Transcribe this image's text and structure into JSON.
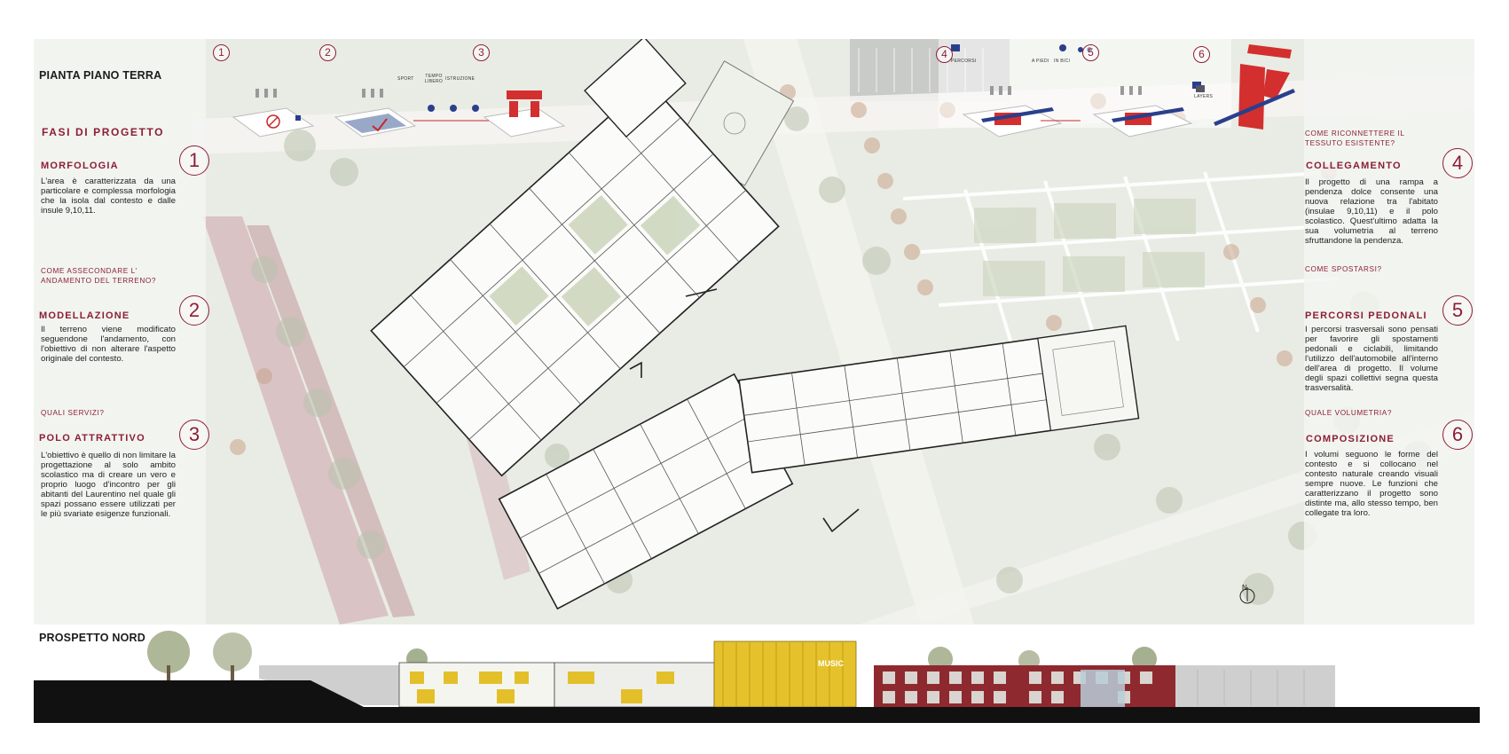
{
  "plan_title": "PIANTA PIANO TERRA",
  "elevation_title": "PROSPETTO NORD",
  "phases_title": "FASI DI PROGETTO",
  "steps": [
    {
      "number": "1",
      "question": "",
      "heading": "MORFOLOGIA",
      "body": "L'area è caratterizzata da una particolare e complessa morfologia che la isola dal contesto e dalle insule 9,10,11."
    },
    {
      "number": "2",
      "question": "COME ASSECONDARE L' ANDAMENTO DEL TERRENO?",
      "heading": "MODELLAZIONE",
      "body": "Il terreno viene modificato seguendone l'andamento, con l'obiettivo di non alterare l'aspetto originale del contesto."
    },
    {
      "number": "3",
      "question": "QUALI SERVIZI?",
      "heading": "POLO ATTRATTIVO",
      "body": "L'obiettivo è quello di non limitare la progettazione al solo ambito scolastico ma di creare un vero e proprio luogo d'incontro per gli abitanti del Laurentino nel quale gli spazi possano essere utilizzati per le più svariate esigenze funzionali."
    },
    {
      "number": "4",
      "question": "COME RICONNETTERE IL TESSUTO ESISTENTE?",
      "heading": "COLLEGAMENTO",
      "body": "Il progetto di una rampa a pendenza dolce consente una nuova relazione tra l'abitato (insulae 9,10,11) e il polo scolastico. Quest'ultimo adatta la sua volumetria al terreno sfruttandone la pendenza."
    },
    {
      "number": "5",
      "question": "COME SPOSTARSI?",
      "heading": "PERCORSI PEDONALI",
      "body": "I percorsi trasversali sono pensati per favorire gli spostamenti pedonali e ciclabili, limitando l'utilizzo dell'automobile all'interno dell'area di progetto. Il volume degli spazi collettivi segna questa trasversalità."
    },
    {
      "number": "6",
      "question": "QUALE VOLUMETRIA?",
      "heading": "COMPOSIZIONE",
      "body": "I volumi seguono le forme del contesto e si collocano nel contesto naturale creando visuali sempre nuove. Le funzioni che caratterizzano il progetto sono distinte ma, allo stesso tempo, ben collegate tra loro."
    }
  ],
  "diagram_labels": {
    "sport": "SPORT",
    "tempo_libero": "TEMPO LIBERO",
    "istruzione": "ISTRUZIONE",
    "percorsi": "PERCORSI",
    "a_piedi": "A PIEDI",
    "in_bici": "IN BICI",
    "layers": "LAYERS"
  },
  "north_label": "N",
  "elevation_sign": "MUSIC",
  "colors": {
    "accent": "#8c1e36",
    "plan_background": "#e9ece4",
    "building_yellow": "#e3c02a",
    "building_red": "#8e2a2f",
    "ground": "#111111"
  }
}
